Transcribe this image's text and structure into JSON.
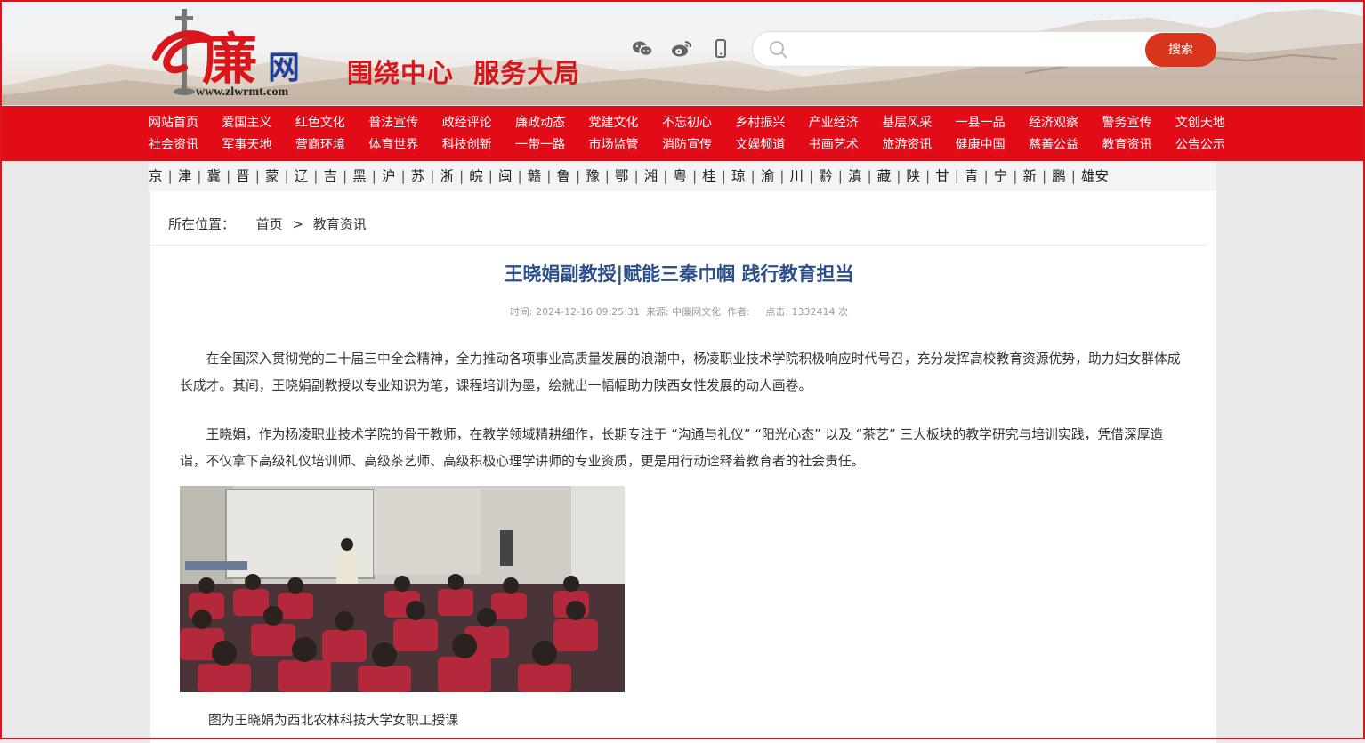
{
  "header": {
    "logo_text": "中廉网",
    "logo_url_text": "www.zlwrmt.com",
    "slogan": "围绕中心  服务大局",
    "social_icons": [
      "wechat-icon",
      "weibo-icon",
      "mobile-icon"
    ],
    "search": {
      "placeholder": "",
      "button_label": "搜索"
    }
  },
  "nav": {
    "row1": [
      "网站首页",
      "爱国主义",
      "红色文化",
      "普法宣传",
      "政经评论",
      "廉政动态",
      "党建文化",
      "不忘初心",
      "乡村振兴",
      "产业经济",
      "基层风采",
      "一县一品",
      "经济观察",
      "警务宣传",
      "文创天地"
    ],
    "row2": [
      "社会资讯",
      "军事天地",
      "营商环境",
      "体育世界",
      "科技创新",
      "一带一路",
      "市场监管",
      "消防宣传",
      "文娱频道",
      "书画艺术",
      "旅游资讯",
      "健康中国",
      "慈善公益",
      "教育资讯",
      "公告公示"
    ]
  },
  "regions": [
    "京",
    "津",
    "冀",
    "晋",
    "蒙",
    "辽",
    "吉",
    "黑",
    "沪",
    "苏",
    "浙",
    "皖",
    "闽",
    "赣",
    "鲁",
    "豫",
    "鄂",
    "湘",
    "粤",
    "桂",
    "琼",
    "渝",
    "川",
    "黔",
    "滇",
    "藏",
    "陕",
    "甘",
    "青",
    "宁",
    "新",
    "鹏",
    "雄安"
  ],
  "breadcrumb": {
    "label": "所在位置：",
    "home": "首页",
    "separator": ">",
    "current": "教育资讯"
  },
  "article": {
    "title": "王晓娟副教授|赋能三秦巾帼 践行教育担当",
    "meta": "时间: 2024-12-16 09:25:31  来源: 中廉网文化  作者:     点击: 1332414 次",
    "paragraphs": [
      "在全国深入贯彻党的二十届三中全会精神，全力推动各项事业高质量发展的浪潮中，杨凌职业技术学院积极响应时代号召，充分发挥高校教育资源优势，助力妇女群体成长成才。其间，王晓娟副教授以专业知识为笔，课程培训为墨，绘就出一幅幅助力陕西女性发展的动人画卷。",
      "王晓娟，作为杨凌职业技术学院的骨干教师，在教学领域精耕细作，长期专注于 “沟通与礼仪” “阳光心态” 以及 “茶艺” 三大板块的教学研究与培训实践，凭借深厚造诣，不仅拿下高级礼仪培训师、高级茶艺师、高级积极心理学讲师的专业资质，更是用行动诠释着教育者的社会责任。"
    ],
    "photo_caption": "图为王晓娟为西北农林科技大学女职工授课"
  },
  "colors": {
    "brand_red": "#e20c18",
    "title_blue": "#2c4f8a",
    "search_button": "#d9341c"
  }
}
